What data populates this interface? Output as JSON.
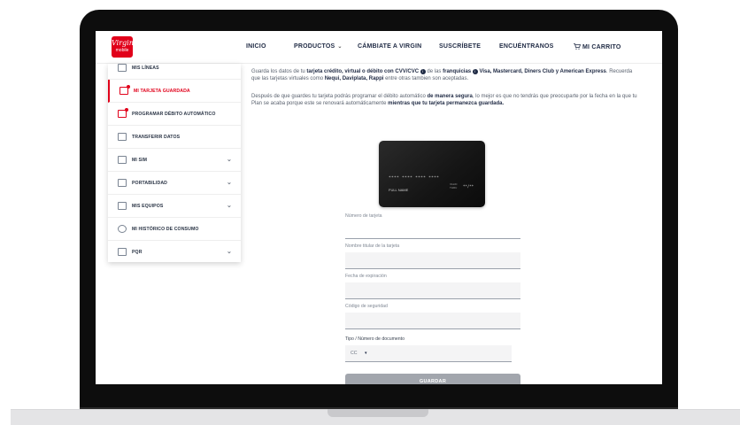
{
  "brand": {
    "logo_top": "Virgin",
    "logo_sub": "mobile",
    "accent": "#e1001a",
    "navy": "#1f2a44"
  },
  "nav": {
    "items": [
      {
        "label": "INICIO"
      },
      {
        "label": "PRODUCTOS",
        "icon": "chevron-down-icon"
      },
      {
        "label": "CÁMBIATE A VIRGIN"
      },
      {
        "label": "SUSCRÍBETE"
      },
      {
        "label": "ENCUÉNTRANOS"
      },
      {
        "label": "MI CARRITO",
        "icon": "cart-icon"
      }
    ]
  },
  "sidebar": {
    "items": [
      {
        "label": "MIS LÍNEAS",
        "icon": "phone-icon"
      },
      {
        "label": "MI TARJETA GUARDADA",
        "icon": "credit-card-icon",
        "active": true
      },
      {
        "label": "PROGRAMAR DÉBITO AUTOMÁTICO",
        "icon": "credit-card-icon"
      },
      {
        "label": "TRANSFERIR DATOS",
        "icon": "transfer-icon"
      },
      {
        "label": "MI SIM",
        "icon": "sim-icon",
        "expandable": true
      },
      {
        "label": "PORTABILIDAD",
        "icon": "portability-icon",
        "expandable": true
      },
      {
        "label": "MIS EQUIPOS",
        "icon": "devices-icon",
        "expandable": true
      },
      {
        "label": "MI HISTÓRICO DE CONSUMO",
        "icon": "history-icon"
      },
      {
        "label": "PQR",
        "icon": "support-icon",
        "expandable": true
      }
    ]
  },
  "content": {
    "p1": {
      "t1": "Guarda los datos de tu ",
      "b1": "tarjeta crédito, virtual o débito con CVV/CVC",
      "t2": " de las ",
      "b2": "franquicias",
      "b3": "Visa, Mastercard, Diners Club y American Express",
      "t3": ". Recuerda que las tarjetas virtuales como ",
      "b4": "Nequi, Daviplata, Rappi",
      "t4": " entre otras tambien son aceptadas."
    },
    "p2": {
      "t1": "Después de que guardes tu tarjeta podrás programar el débito automático ",
      "b1": "de manera segura",
      "t2": ", lo mejor es que no tendrás que preocuparte por la fecha en la que tu Plan se acaba porque este se renovará automáticamente ",
      "b2": "mientras que tu tarjeta permanezca guardada."
    }
  },
  "card": {
    "number": "**** **** **** ****",
    "name": "FULL NAME",
    "valid_label_1": "VALID",
    "valid_label_2": "THRU",
    "expiry": "**/**"
  },
  "form": {
    "fields": [
      {
        "label": "Número de tarjeta"
      },
      {
        "label": "Nombre titular de la tarjeta"
      },
      {
        "label": "Fecha de expiración"
      },
      {
        "label": "Código de seguridad"
      }
    ],
    "doc_label": "Tipo / Número de documento",
    "doc_type": "CC",
    "submit": "GUARDAR"
  }
}
